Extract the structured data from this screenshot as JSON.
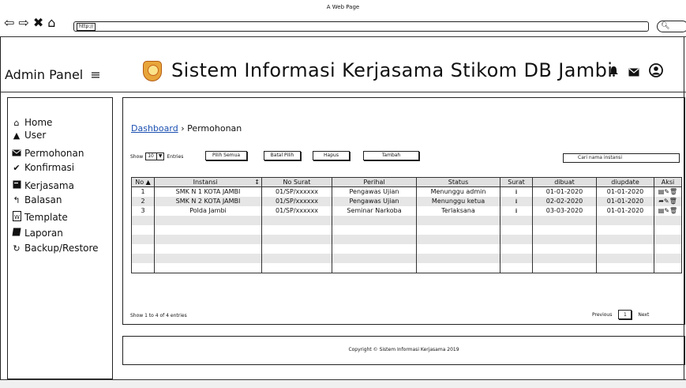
{
  "browser": {
    "title": "A Web Page",
    "url": "http://",
    "nav_icons": [
      "back-icon",
      "forward-icon",
      "stop-icon",
      "home-icon"
    ]
  },
  "header": {
    "admin_label": "Admin Panel",
    "menu_glyph": "≡",
    "app_title": "Sistem Informasi Kerjasama Stikom DB Jambi",
    "icons": [
      "bell-icon",
      "envelope-icon",
      "user-icon"
    ]
  },
  "sidebar": {
    "items": [
      {
        "label": "Home",
        "icon": "home-icon"
      },
      {
        "label": "User",
        "icon": "user-icon"
      },
      {
        "label": "Permohonan",
        "icon": "envelope-icon"
      },
      {
        "label": "Konfirmasi",
        "icon": "check-icon"
      },
      {
        "label": "Kerjasama",
        "icon": "document-icon"
      },
      {
        "label": "Balasan",
        "icon": "reply-icon"
      },
      {
        "label": "Template",
        "icon": "word-file-icon"
      },
      {
        "label": "Laporan",
        "icon": "book-icon"
      },
      {
        "label": "Backup/Restore",
        "icon": "refresh-icon"
      }
    ]
  },
  "breadcrumb": {
    "root": "Dashboard",
    "separator": "›",
    "current": "Permohonan"
  },
  "controls": {
    "show_label": "Show",
    "entries_value": "10",
    "entries_label": "Entries",
    "buttons": {
      "select_all": "Pilih Semua",
      "unselect": "Batal Pilih",
      "delete": "Hapus",
      "add": "Tambah"
    },
    "search_placeholder": "Cari nama instansi"
  },
  "table": {
    "columns": [
      "No",
      "Instansi",
      "No Surat",
      "Perihal",
      "Status",
      "Surat",
      "dibuat",
      "diupdate",
      "Aksi"
    ],
    "rows": [
      {
        "no": "1",
        "instansi": "SMK N 1 KOTA JAMBI",
        "no_surat": "01/SP/xxxxxx",
        "perihal": "Pengawas Ujian",
        "status": "Menunggu admin",
        "dibuat": "01-01-2020",
        "diupdate": "01-01-2020",
        "aksi": "▤✎🗑"
      },
      {
        "no": "2",
        "instansi": "SMK N 2 KOTA JAMBI",
        "no_surat": "01/SP/xxxxxx",
        "perihal": "Pengawas Ujian",
        "status": "Menunggu ketua",
        "dibuat": "02-02-2020",
        "diupdate": "01-01-2020",
        "aksi": "➦✎🗑"
      },
      {
        "no": "3",
        "instansi": "Polda Jambi",
        "no_surat": "01/SP/xxxxxx",
        "perihal": "Seminar Narkoba",
        "status": "Terlaksana",
        "dibuat": "03-03-2020",
        "diupdate": "01-01-2020",
        "aksi": "▤✎🗑"
      }
    ],
    "empty_rows": 6
  },
  "pagination": {
    "info": "Show 1 to 4 of 4 entries",
    "previous": "Previous",
    "page": "1",
    "next": "Next"
  },
  "footer": {
    "copyright": "Copyright © Sistem Informasi Kerjasama 2019"
  }
}
